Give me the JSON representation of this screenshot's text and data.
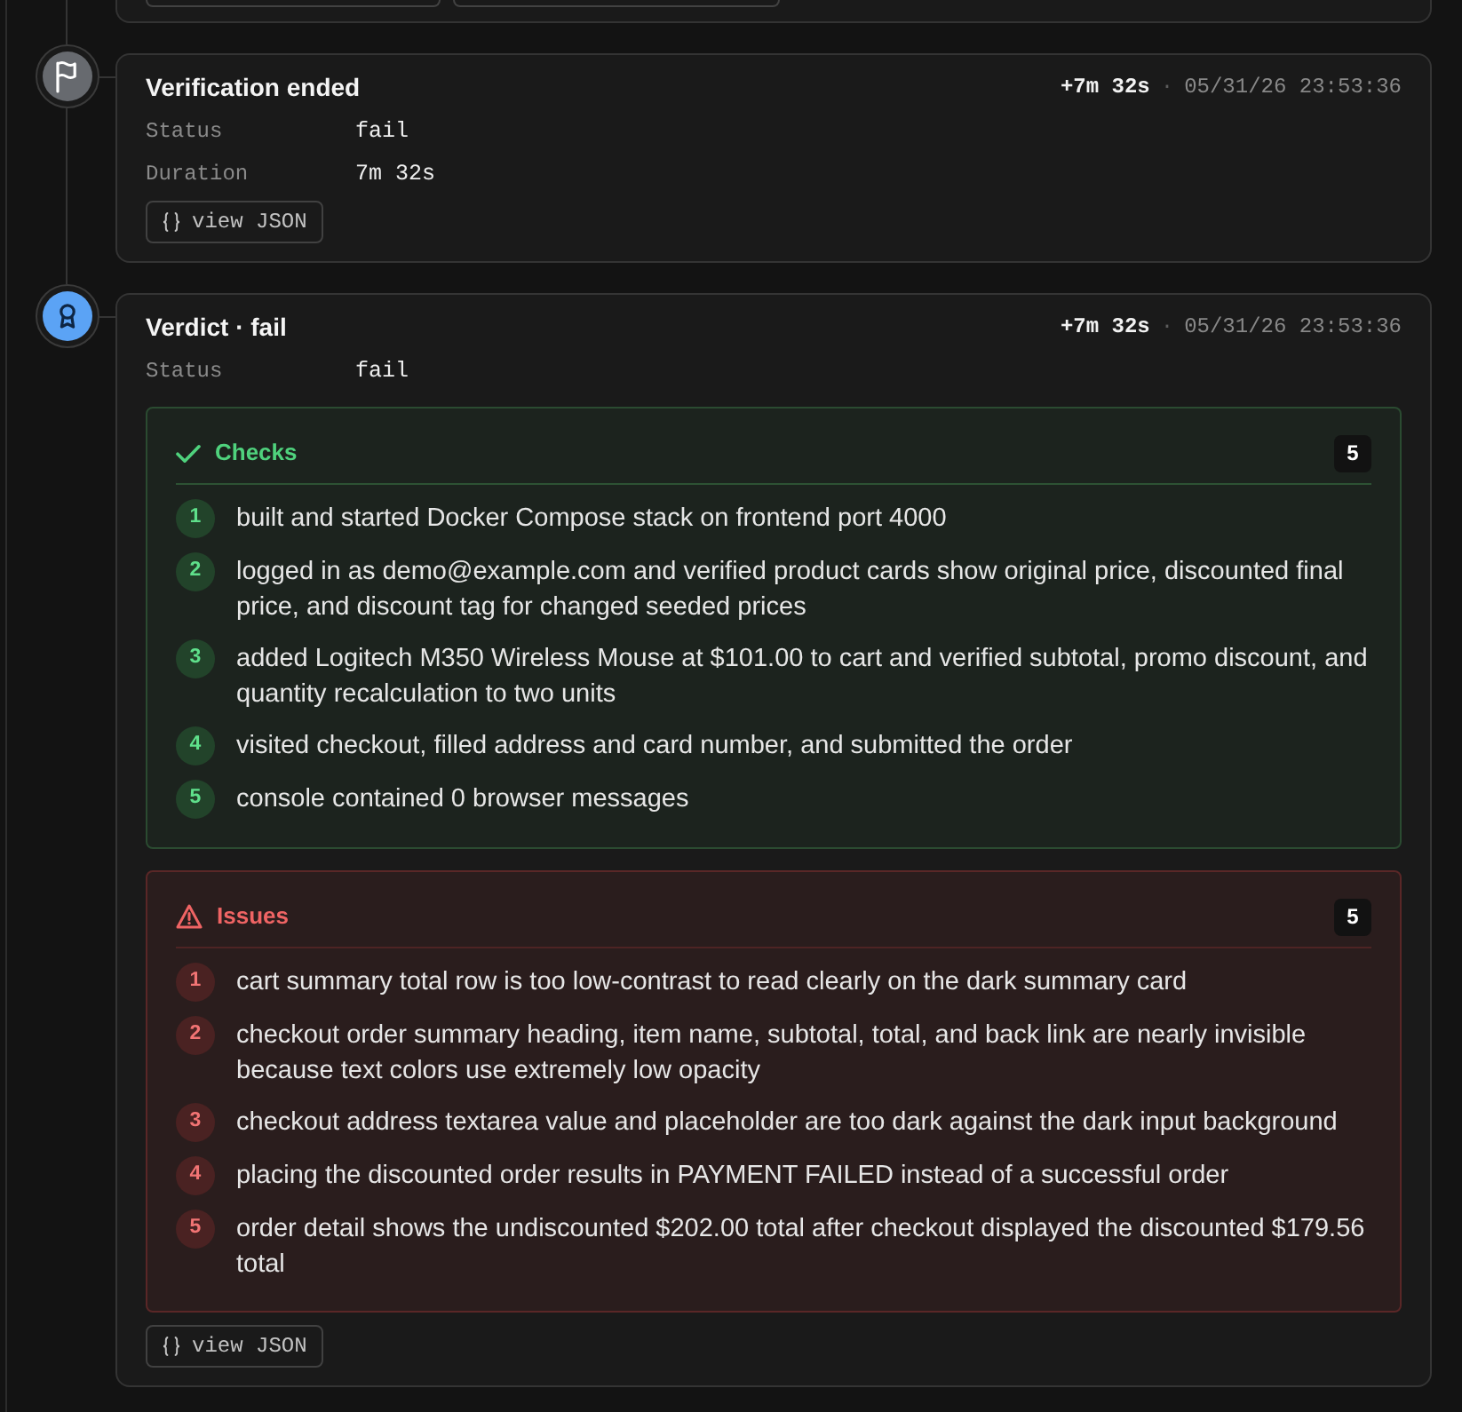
{
  "previous_event": {
    "buttons": [
      {
        "kind": "outline"
      },
      {
        "kind": "outline"
      }
    ]
  },
  "events": [
    {
      "kind": "ended",
      "title": "Verification ended",
      "elapsed": "+7m 32s",
      "separator": "·",
      "timestamp": "05/31/26 23:53:36",
      "fields": [
        {
          "label": "Status",
          "value": "fail"
        },
        {
          "label": "Duration",
          "value": "7m 32s"
        }
      ],
      "button": "view JSON"
    },
    {
      "kind": "verdict",
      "title": "Verdict · fail",
      "elapsed": "+7m 32s",
      "separator": "·",
      "timestamp": "05/31/26 23:53:36",
      "fields": [
        {
          "label": "Status",
          "value": "fail"
        }
      ],
      "sections": [
        {
          "kind": "checks",
          "title": "Checks",
          "count": "5",
          "items": [
            {
              "number": "1",
              "text": "built and started Docker Compose stack on frontend port 4000"
            },
            {
              "number": "2",
              "text": "logged in as demo@example.com and verified product cards show original price, discounted final price, and discount tag for changed seeded prices"
            },
            {
              "number": "3",
              "text": "added Logitech M350 Wireless Mouse at $101.00 to cart and verified subtotal, promo discount, and quantity recalculation to two units"
            },
            {
              "number": "4",
              "text": "visited checkout, filled address and card number, and submitted the order"
            },
            {
              "number": "5",
              "text": "console contained 0 browser messages"
            }
          ]
        },
        {
          "kind": "issues",
          "title": "Issues",
          "count": "5",
          "items": [
            {
              "number": "1",
              "text": "cart summary total row is too low-contrast to read clearly on the dark summary card"
            },
            {
              "number": "2",
              "text": "checkout order summary heading, item name, subtotal, total, and back link are nearly invisible because text colors use extremely low opacity"
            },
            {
              "number": "3",
              "text": "checkout address textarea value and placeholder are too dark against the dark input background"
            },
            {
              "number": "4",
              "text": "placing the discounted order results in PAYMENT FAILED instead of a successful order"
            },
            {
              "number": "5",
              "text": "order detail shows the undiscounted $202.00 total after checkout displayed the discounted $179.56 total"
            }
          ]
        }
      ],
      "button": "view JSON"
    }
  ]
}
